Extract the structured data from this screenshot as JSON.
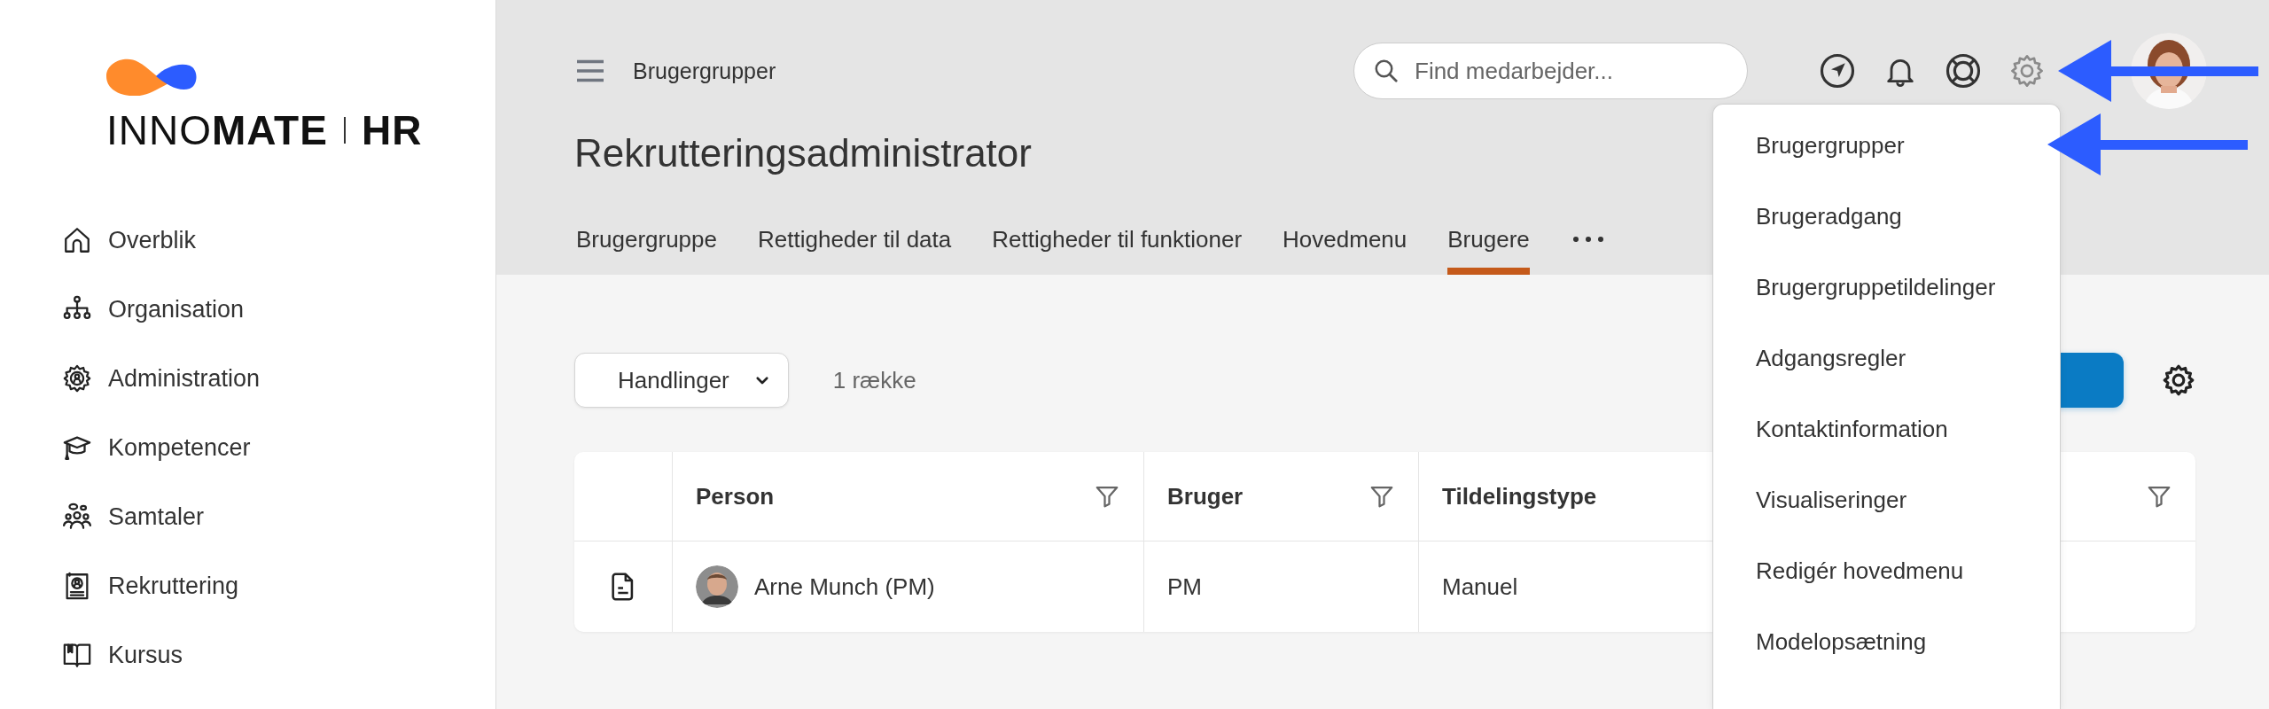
{
  "logo": {
    "wordmark": "INNO**MATE**",
    "product": "HR"
  },
  "sidebar": {
    "items": [
      {
        "label": "Overblik"
      },
      {
        "label": "Organisation"
      },
      {
        "label": "Administration"
      },
      {
        "label": "Kompetencer"
      },
      {
        "label": "Samtaler"
      },
      {
        "label": "Rekruttering"
      },
      {
        "label": "Kursus"
      }
    ]
  },
  "header": {
    "breadcrumb": "Brugergrupper",
    "search": {
      "placeholder": "Find medarbejder..."
    },
    "title": "Rekrutteringsadministrator",
    "tabs": [
      {
        "label": "Brugergruppe",
        "selected": false
      },
      {
        "label": "Rettigheder til data",
        "selected": false
      },
      {
        "label": "Rettigheder til funktioner",
        "selected": false
      },
      {
        "label": "Hovedmenu",
        "selected": false
      },
      {
        "label": "Brugere",
        "selected": true
      }
    ]
  },
  "toolbar": {
    "actions_button": "Handlinger",
    "row_count": "1 række"
  },
  "table": {
    "columns": [
      {
        "label": "Person"
      },
      {
        "label": "Bruger"
      },
      {
        "label": "Tildelingstype"
      }
    ],
    "rows": [
      {
        "cells": [
          "Arne Munch (PM)",
          "PM",
          "Manuel"
        ]
      }
    ]
  },
  "settings_menu": {
    "items": [
      {
        "label": "Brugergrupper"
      },
      {
        "label": "Brugeradgang"
      },
      {
        "label": "Brugergruppetildelinger"
      },
      {
        "label": "Adgangsregler"
      },
      {
        "label": "Kontaktinformation"
      },
      {
        "label": "Visualiseringer"
      },
      {
        "label": "Redigér hovedmenu"
      },
      {
        "label": "Modelopsætning"
      }
    ]
  }
}
